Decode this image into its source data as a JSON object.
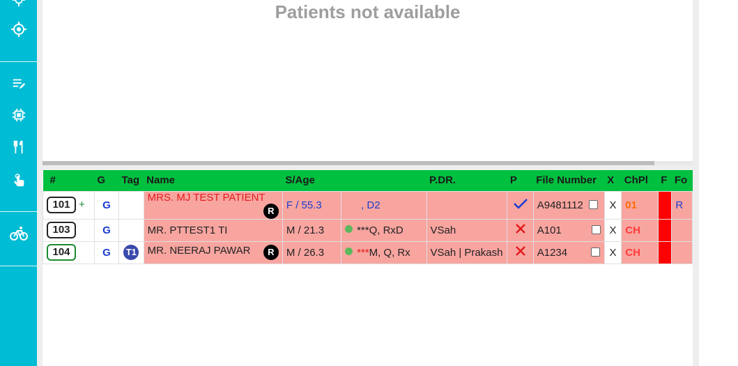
{
  "sidebar": {
    "icons": [
      "gps-icon",
      "crosshair-icon",
      "edit-list-icon",
      "chip-icon",
      "dining-icon",
      "hand-touch-icon",
      "bicycle-icon"
    ]
  },
  "top_panel": {
    "message": "Patients not available"
  },
  "table": {
    "headers": [
      "#",
      "G",
      "Tag",
      "Name",
      "S/Age",
      "",
      "P.DR.",
      "P",
      "File Number",
      "X",
      "ChPl",
      "F",
      "Fo"
    ],
    "rows": [
      {
        "num": "101",
        "plus": "+",
        "g": "G",
        "tag": "",
        "name": "MRS. MJ TEST PATIENT",
        "r_badge": "R",
        "sage": "F / 55.3",
        "details_prefix": "",
        "details": ", D2",
        "pdr": "",
        "p_icon": "check-icon",
        "file": "A9481112",
        "x": "X",
        "chpl": "01",
        "fo": "R"
      },
      {
        "num": "103",
        "plus": "",
        "g": "G",
        "tag": "",
        "name": "MR. PTTEST1 TI",
        "r_badge": "",
        "sage": "M / 21.3",
        "details_prefix": "",
        "details": "***Q, RxD",
        "pdr": "VSah",
        "p_icon": "cross-icon",
        "file": "A101",
        "x": "X",
        "chpl": "CH",
        "fo": ""
      },
      {
        "num": "104",
        "plus": "",
        "g": "G",
        "tag": "T1",
        "name": "MR. NEERAJ PAWAR",
        "r_badge": "R",
        "sage": "M / 26.3",
        "details_prefix": "***",
        "details": "M, Q, Rx",
        "pdr": "VSah | Prakash",
        "p_icon": "cross-icon",
        "file": "A1234",
        "x": "X",
        "chpl": "CH",
        "fo": ""
      }
    ]
  },
  "colors": {
    "sidebar": "#00bcd4",
    "header_green": "#00c040",
    "row_pink": "#f8a5a0",
    "flag_red": "#ff0000"
  }
}
